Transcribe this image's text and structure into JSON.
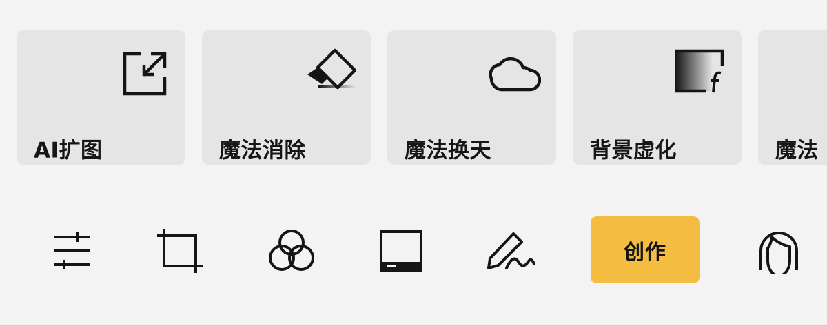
{
  "feature_cards": [
    {
      "label": "AI扩图",
      "icon": "expand-image-icon"
    },
    {
      "label": "魔法消除",
      "icon": "eraser-icon"
    },
    {
      "label": "魔法换天",
      "icon": "cloud-icon"
    },
    {
      "label": "背景虚化",
      "icon": "background-blur-icon"
    },
    {
      "label": "魔法",
      "icon": ""
    }
  ],
  "toolbar": {
    "tools": [
      {
        "name": "adjust",
        "icon": "sliders-icon"
      },
      {
        "name": "crop",
        "icon": "crop-icon"
      },
      {
        "name": "filter",
        "icon": "filter-circles-icon"
      },
      {
        "name": "frame",
        "icon": "frame-icon"
      },
      {
        "name": "draw",
        "icon": "pencil-signature-icon"
      },
      {
        "name": "portrait",
        "icon": "portrait-icon"
      }
    ],
    "create_label": "创作",
    "create_color": "#f4bd41"
  }
}
